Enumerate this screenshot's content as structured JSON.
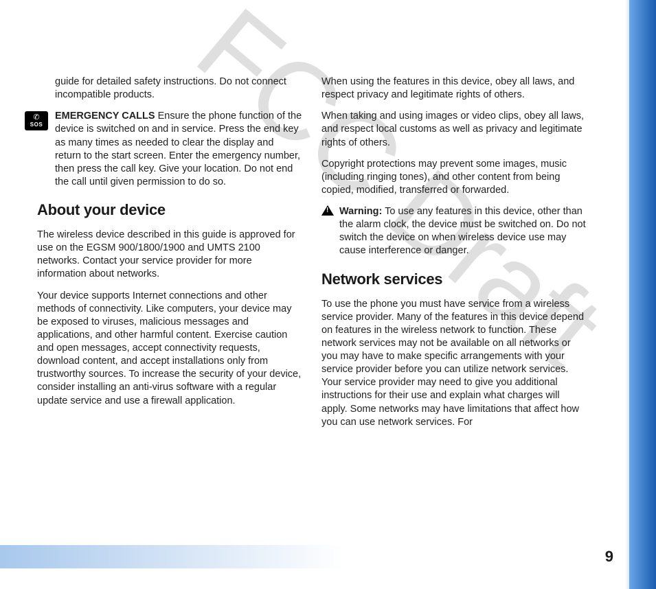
{
  "watermark": "FCC Draft",
  "page_number": "9",
  "col1": {
    "intro_tail": "guide for detailed safety instructions. Do not connect incompatible products.",
    "sos_label": "EMERGENCY CALLS",
    "sos_text": " Ensure the phone function of the device is switched on and in service. Press the end key as many times as needed to clear the display and return to the start screen. Enter the emergency number, then press the call key. Give your location. Do not end the call until given permission to do so.",
    "h_about": "About your device",
    "about_p1": "The wireless device described in this guide is approved for use on the EGSM 900/1800/1900 and UMTS 2100 networks. Contact your service provider for more information about networks.",
    "about_p2": "Your device supports Internet connections and other methods of connectivity. Like computers, your device may be exposed to viruses, malicious messages and applications, and other harmful content. Exercise caution and open messages, accept connectivity requests, download content, and accept installations only from trustworthy sources. To increase the security of your device, consider installing an anti-virus software with a regular update service and use a firewall application."
  },
  "col2": {
    "p1": "When using the features in this device, obey all laws, and respect privacy and legitimate rights of others.",
    "p2": "When taking and using images or video clips, obey all laws, and respect local customs as well as privacy and legitimate rights of others.",
    "p3": "Copyright protections may prevent some images, music (including ringing tones), and other content from being copied, modified, transferred or forwarded.",
    "warn_label": "Warning:",
    "warn_text": " To use any features in this device, other than the alarm clock, the device must be switched on. Do not switch the device on when wireless device use may cause interference or danger.",
    "h_network": "Network services",
    "net_p1": "To use the phone you must have service from a wireless service provider. Many of the features in this device depend on features in the wireless network to function. These network services may not be available on all networks or you may have to make specific arrangements with your service provider before you can utilize network services. Your service provider may need to give you additional instructions for their use and explain what charges will apply. Some networks may have limitations that affect how you can use network services. For"
  }
}
